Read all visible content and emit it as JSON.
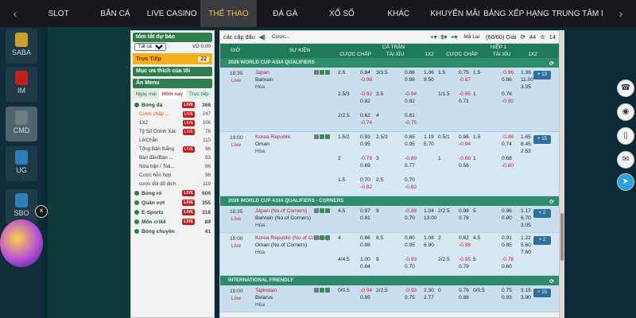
{
  "nav": {
    "left_arrow": "‹",
    "right_arrow": "›",
    "items": [
      "SLOT",
      "BẮN CÁ",
      "LIVE CASINO",
      "THỂ THAO",
      "ĐÁ GÀ",
      "XỔ SỐ",
      "KHÁC",
      "KHUYẾN MÃI",
      "BẢNG XẾP HẠNG",
      "TRUNG TÂM I"
    ],
    "active_index": 3
  },
  "rail": {
    "tiles": [
      {
        "label": "SABA",
        "color": "#c9a227"
      },
      {
        "label": "IM",
        "color": "#c41f1f"
      },
      {
        "label": "CMD",
        "color": "#6f7c86"
      },
      {
        "label": "UG",
        "color": "#2c7fb8"
      },
      {
        "label": "SBO",
        "color": "#2c7fb8"
      }
    ],
    "close": "×"
  },
  "sidebar": {
    "summary_title": "tóm tắt dự báo",
    "filter_value": "Tất cả",
    "balance": "VD 0.00",
    "live_label": "Trực Tiếp",
    "live_count": "22",
    "favorites": "Mục ưa thích của tôi",
    "menu_title": "Ẩn Menu",
    "tabs": [
      "Ngày mai",
      "Hôm nay",
      "Trực tiếp"
    ],
    "tabs_active": 1,
    "sports": [
      {
        "name": "Bóng đá",
        "live": "LIVE",
        "count": "366",
        "subs": [
          {
            "name": "Cược chấp ...",
            "live": "LIVE",
            "count": "247",
            "selected": true
          },
          {
            "name": "1X2",
            "live": "LIVE",
            "count": "106"
          },
          {
            "name": "Tỷ Số Chính Xác",
            "live": "LIVE",
            "count": "76"
          },
          {
            "name": "Lẻ/Chẵn",
            "live": "",
            "count": "110"
          },
          {
            "name": "Tổng Bàn thắng",
            "live": "LIVE",
            "count": "96"
          },
          {
            "name": "Bàn đầu/Bàn ...",
            "live": "",
            "count": "93"
          },
          {
            "name": "Nửa trận / Toả...",
            "live": "",
            "count": "96"
          },
          {
            "name": "Cược hỗn hợp",
            "live": "",
            "count": "98"
          },
          {
            "name": "cược dồi dồ dịch",
            "live": "",
            "count": "119"
          }
        ]
      },
      {
        "name": "Bóng rổ",
        "live": "LIVE",
        "count": "606",
        "subs": []
      },
      {
        "name": "Quần vợt",
        "live": "LIVE",
        "count": "355",
        "subs": []
      },
      {
        "name": "E-Sports",
        "live": "LIVE",
        "count": "318",
        "subs": []
      },
      {
        "name": "Môn crikê",
        "live": "LIVE",
        "count": "89",
        "subs": []
      },
      {
        "name": "Bóng chuyền",
        "live": "",
        "count": "41",
        "subs": []
      }
    ]
  },
  "toolbar": {
    "label": "các cặp đấu",
    "select1": "Cược...",
    "odds_type": "Mã Lai",
    "paging": "(60/60) Giải",
    "count1": "44",
    "count2": "14"
  },
  "header": {
    "time": "GIỜ",
    "event": "SỰ KIỆN",
    "full_match": "CẢ TRẬN",
    "half1": "HIỆP 1",
    "handicap": "CƯỢC CHẤP",
    "overunder": "TÀI XỈU",
    "x12": "1X2"
  },
  "leagues": [
    {
      "name": "2026 WORLD CUP ASIA QUALIFIERS",
      "matches": [
        {
          "time": "18:35",
          "live": "Live",
          "home": "Japan",
          "away": "Bahrain",
          "draw": "Hòa",
          "more": "+ 13",
          "lines": [
            [
              "2.5",
              "0.84",
              "-0.96",
              "3/3.5",
              "",
              "0.88",
              "0.98",
              "1.06",
              "9.50",
              "1.5",
              "0.75",
              "-0.87",
              "1.5",
              "-0.96",
              "0.86",
              "1.36",
              "11.00",
              "3.35"
            ],
            [
              "2.5/3",
              "-0.92",
              "0.82",
              "3.5",
              "",
              "-0.94",
              "0.82",
              "",
              "",
              "1/1.5",
              "-0.85",
              "0.71",
              "1",
              "0.76",
              "-0.90",
              "",
              "",
              ""
            ],
            [
              "2/2.5",
              "0.62",
              "-0.74",
              "4",
              "",
              "0.61",
              "-0.75",
              "",
              "",
              "",
              "",
              "",
              "",
              "",
              "",
              "",
              "",
              ""
            ]
          ]
        },
        {
          "time": "19:00",
          "live": "Live",
          "home": "Korea Republic",
          "away": "Oman",
          "draw": "Hòa",
          "more": "+ 15",
          "lines": [
            [
              "1.5/2",
              "0.93",
              "0.95",
              "2.5/3",
              "",
              "0.85",
              "0.95",
              "1.19",
              "5.70",
              "0.5/1",
              "0.86",
              "-0.94",
              "1.5",
              "-0.88",
              "0.74",
              "1.65",
              "8.45",
              "2.53"
            ],
            [
              "2",
              "-0.78",
              "0.69",
              "3",
              "",
              "-0.89",
              "0.77",
              "",
              "",
              "1",
              "-0.68",
              "0.56",
              "1",
              "0.68",
              "-0.80",
              "",
              "",
              ""
            ],
            [
              "1.5",
              "0.70",
              "-0.82",
              "2.5",
              "",
              "0.70",
              "-0.82",
              "",
              "",
              "",
              "",
              "",
              "",
              "",
              "",
              "",
              "",
              ""
            ]
          ]
        }
      ]
    },
    {
      "name": "2026 WORLD CUP ASIA QUALIFIERS - CORNERS",
      "matches": [
        {
          "time": "18:35",
          "live": "Live",
          "home": "Japan (No.of Corners)",
          "away": "Bahrain (No.of Corners)",
          "draw": "Hòa",
          "more": "+ 2",
          "lines": [
            [
              "4.5",
              "0.97",
              "0.81",
              "9",
              "",
              "-0.88",
              "0.70",
              "1.04",
              "13.00",
              "2/2.5",
              "0.98",
              "0.78",
              "5",
              "0.96",
              "0.80",
              "1.17",
              "6.70",
              "3.05"
            ]
          ]
        },
        {
          "time": "19:00",
          "live": "Live",
          "home": "Korea Republic (No.of Corners)",
          "away": "Oman (No.of Corners)",
          "draw": "Hòa",
          "more": "+ 2",
          "lines": [
            [
              "4",
              "0.86",
              "0.98",
              "8.5",
              "",
              "0.80",
              "0.95",
              "1.08",
              "6.90",
              "2",
              "0.82",
              "-0.98",
              "4.5",
              "0.91",
              "0.85",
              "1.22",
              "5.60",
              "7.60"
            ],
            [
              "4/4.5",
              "1.00",
              "0.84",
              "9",
              "",
              "-0.93",
              "0.70",
              "",
              "",
              "2/2.5",
              "-0.95",
              "0.79",
              "5",
              "-0.78",
              "0.60",
              "",
              "",
              ""
            ]
          ]
        }
      ]
    },
    {
      "name": "INTERNATIONAL FRIENDLY",
      "matches": [
        {
          "time": "19:00",
          "live": "Live",
          "home": "Tajikistan",
          "away": "Belarus",
          "draw": "Hòa",
          "more": "+ 15",
          "lines": [
            [
              "0/0.5",
              "-0.94",
              "0.85",
              "2/2.5",
              "",
              "-0.93",
              "0.75",
              "2.30",
              "2.77",
              "0",
              "0.79",
              "0.88",
              "0/0.5",
              "0.75",
              "0.93",
              "3.15",
              "3.90",
              ""
            ]
          ]
        }
      ]
    }
  ]
}
